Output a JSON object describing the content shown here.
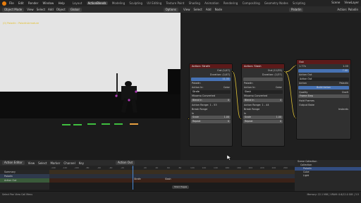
{
  "topbar": {
    "menu": [
      "File",
      "Edit",
      "Render",
      "Window",
      "Help"
    ],
    "workspaces": [
      "Layout",
      "ActionBlends",
      "Modeling",
      "Sculpting",
      "UV Editing",
      "Texture Paint",
      "Shading",
      "Animation",
      "Rendering",
      "Compositing",
      "Geometry Nodes",
      "Scripting"
    ],
    "active_workspace": "ActionBlends",
    "scene": "Scene",
    "view_layer": "ViewLayer"
  },
  "viewport": {
    "mode": "Object Mode",
    "menu": [
      "View",
      "Select",
      "Add",
      "Object"
    ],
    "transform": "Global",
    "options": "Options",
    "overlay_text": "(0) Paladin : PaladinArmature"
  },
  "node_editor": {
    "menu": [
      "View",
      "Select",
      "Add",
      "Node"
    ],
    "object": "Paladin",
    "right_label": "Action: Paladin",
    "nodes": [
      {
        "title": "Action: Strafe",
        "out": "Out (1/47)",
        "duration": "Duration: (1/47)",
        "field": "11.33",
        "object": "Paladin",
        "action_in": "Action In:",
        "color": "Color",
        "action": "Strafe",
        "mixamo": "Mixamo Converted",
        "blend_in": "Blend In",
        "blend_in_val": "0",
        "action_range": "Action Range: 1 - 53",
        "break_range": "Break Range",
        "in": "In",
        "scale": "Scale",
        "scale_val": "1.00",
        "repeat": "Repeat",
        "repeat_val": "0"
      },
      {
        "title": "Action: Slash",
        "out": "Out (11/35)",
        "duration": "Duration: (1/37)",
        "field": "",
        "object": "Paladin",
        "action_in": "Action In:",
        "color": "Color",
        "action": "Slash",
        "mixamo": "Mixamo Converted",
        "blend_in": "Blend In",
        "blend_in_val": "4",
        "action_range": "Action Range: 1 - 44",
        "break_range": "Break Range",
        "in": "In",
        "scale": "Scale",
        "scale_val": "1.00",
        "repeat": "Repeat",
        "repeat_val": "0"
      }
    ],
    "out_node": {
      "title": "Out",
      "speed": "1.77x",
      "frame": "1.00",
      "field": "7.00",
      "action_out": "Action Out",
      "action": "Action Out",
      "object": "Paladin",
      "action_label": "Action",
      "build_action": "Build Action",
      "quality": "Quality",
      "quality_val": "Draft",
      "frame_step": "Frame Step",
      "hold_frames": "Hold Frames",
      "output_bake": "Output Bake",
      "instants": "Instants"
    }
  },
  "timeline": {
    "editor": "Action Editor",
    "menu": [
      "View",
      "Select",
      "Marker",
      "Channel",
      "Key"
    ],
    "action": "Action Out",
    "ruler": [
      "-140",
      "-120",
      "-100",
      "-80",
      "-60",
      "-40",
      "-20",
      "0",
      "20",
      "40",
      "60",
      "80",
      "100",
      "120",
      "140",
      "160",
      "180",
      "200",
      "220",
      "240",
      "260"
    ],
    "channels": [
      "Summary",
      "Paladin",
      "Action Out"
    ],
    "markers": [
      "Strafe",
      "Slash"
    ],
    "current": "Sharc Pages"
  },
  "outliner": {
    "items": [
      "Scene Collection",
      "Collection",
      "Paladin",
      "Cube",
      "Light"
    ]
  },
  "status": {
    "left": "Select   Pan View   Call Menu",
    "right": "Memory: 22.1 MiB | VRAM: 0.6/12.0 GiB | 3.5"
  },
  "colors": {
    "accent": "#e87d0d",
    "node_header": "#5c1a1a",
    "socket": "#e2c435",
    "selected": "#4772b3"
  }
}
